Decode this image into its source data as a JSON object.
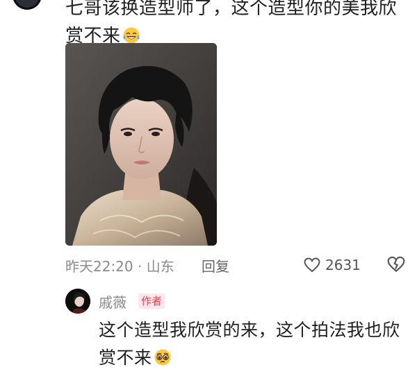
{
  "comment": {
    "text_line1": "七哥该换造型师了，这个造型你的美我欣",
    "text_line2": "赏不来",
    "time_location": "昨天22:20 · 山东",
    "reply_label": "回复",
    "like_count": "2631"
  },
  "reply": {
    "username": "戚薇",
    "badge": "作者",
    "text_line1": "这个造型我欣赏的来，这个拍法我也欣",
    "text_line2": "赏不来"
  },
  "icons": {
    "laughing_emoji": "laugh-cry-icon",
    "pleading_emoji": "pleading-face-icon",
    "like": "heart-outline-icon",
    "dislike": "broken-heart-outline-icon"
  },
  "colors": {
    "badge_bg": "#fde7ec",
    "badge_text": "#e5424d",
    "meta_text": "#8a8a8a",
    "body_text": "#1f1f1f"
  }
}
